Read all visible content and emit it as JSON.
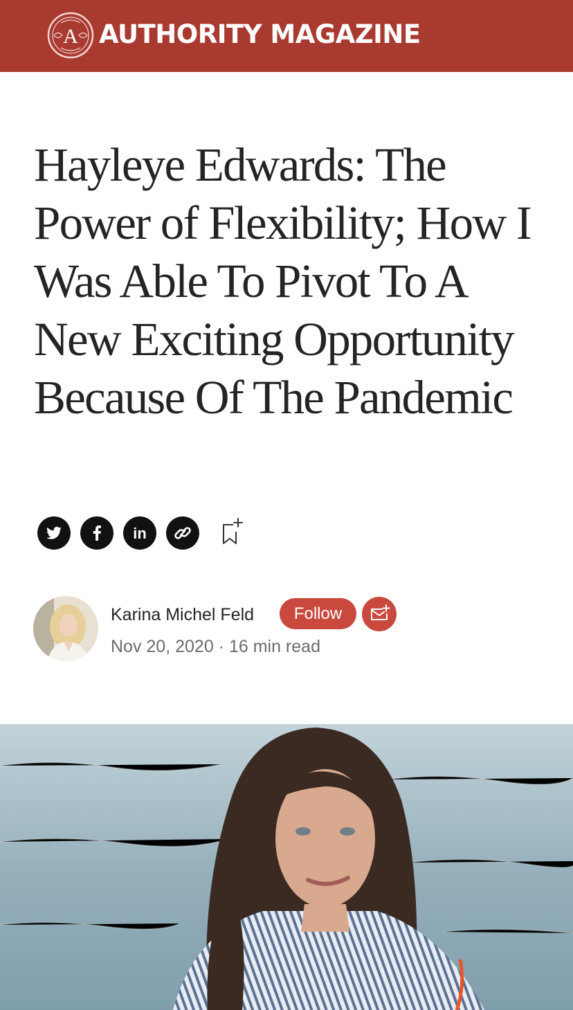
{
  "header": {
    "brand_name": "AUTHORITY MAGAZINE",
    "logo_letter": "A",
    "background_color": "#a93a30"
  },
  "article": {
    "title": "Hayleye Edwards: The Power of Flexibility; How I Was Able To Pivot To A New Exciting Opportunity Because Of The Pandemic"
  },
  "share": {
    "icons": [
      "twitter-icon",
      "facebook-icon",
      "linkedin-icon",
      "link-icon",
      "bookmark-add-icon"
    ]
  },
  "author": {
    "name": "Karina Michel Feld",
    "follow_label": "Follow",
    "date": "Nov 20, 2020",
    "separator": "·",
    "read_time": "16 min read",
    "accent_color": "#c9493f"
  }
}
